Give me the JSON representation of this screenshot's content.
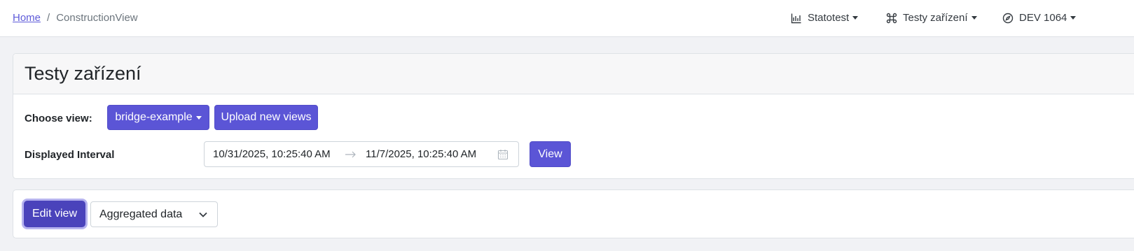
{
  "breadcrumb": {
    "home": "Home",
    "separator": "/",
    "current": "ConstructionView"
  },
  "nav": {
    "statotest": "Statotest",
    "testy": "Testy zařízení",
    "dev": "DEV 1064"
  },
  "page": {
    "title": "Testy zařízení"
  },
  "view_select": {
    "label": "Choose view:",
    "selected": "bridge-example",
    "upload_label": "Upload new views"
  },
  "interval": {
    "label": "Displayed Interval",
    "start": "10/31/2025, 10:25:40 AM",
    "end": "11/7/2025, 10:25:40 AM",
    "view_button": "View"
  },
  "toolbar": {
    "edit_label": "Edit view",
    "data_mode": "Aggregated data"
  },
  "colors": {
    "primary": "#5b55d6",
    "primary_active": "#4a43bb",
    "link": "#5e5bd9"
  }
}
